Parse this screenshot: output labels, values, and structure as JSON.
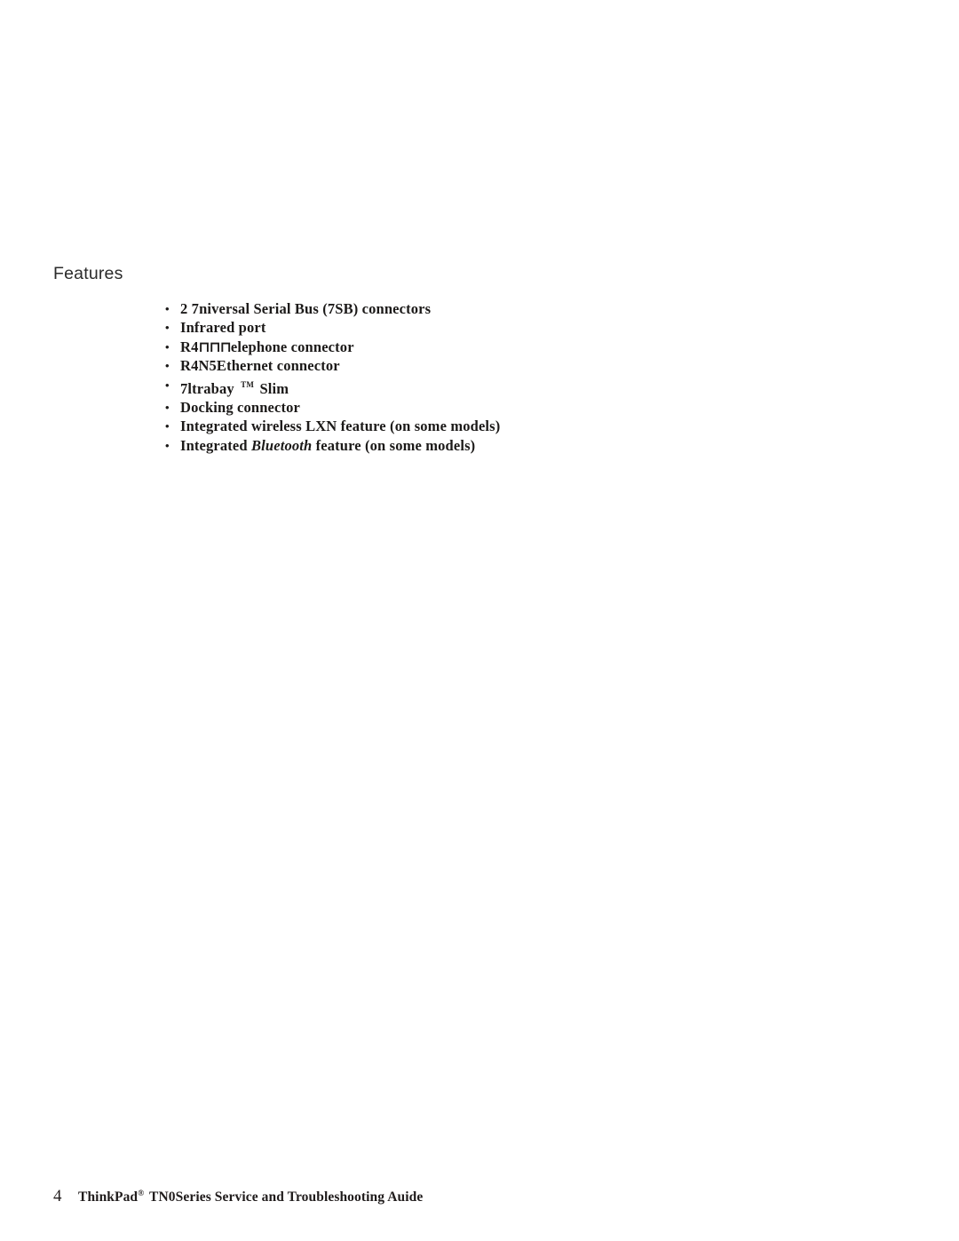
{
  "page": {
    "background_color": "#ffffff",
    "text_color": "#1c1a19",
    "heading_color": "#2b2b2b"
  },
  "section": {
    "heading": "Features"
  },
  "features": {
    "bullet_glyph": "•",
    "items": [
      {
        "text": "2 7niversal  Serial Bus (7SB)  connectors"
      },
      {
        "text": "Infrared port"
      },
      {
        "prefix": "R4",
        "glyph": "⊓⊓⊓",
        "suffix": "elephone  connector"
      },
      {
        "text": "R4N5Ethernet connector"
      },
      {
        "prefix": "7ltrabay ",
        "trademark": "TM",
        "suffix": " Slim"
      },
      {
        "text": "Docking  connector"
      },
      {
        "text": "Integrated  wireless  LXN  feature  (on  some  models)"
      },
      {
        "prefix": "Integrated ",
        "italic": "Bluetooth",
        "suffix": " feature  (on  some  models)"
      }
    ]
  },
  "footer": {
    "page_number": "4",
    "title_part1": "ThinkPad",
    "registered_mark": "®",
    "title_part2": " TN0Series  Service  and  Troubleshooting  Auide"
  }
}
